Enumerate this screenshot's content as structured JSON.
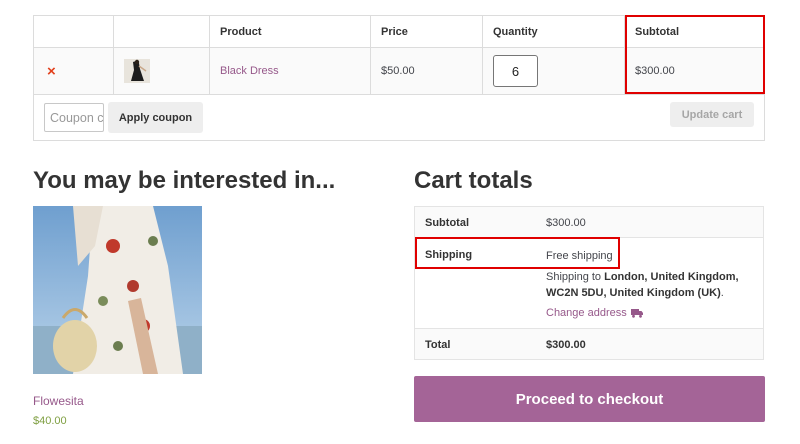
{
  "cart": {
    "headers": {
      "remove": "",
      "thumbnail": "",
      "product": "Product",
      "price": "Price",
      "quantity": "Quantity",
      "subtotal": "Subtotal"
    },
    "item": {
      "remove_symbol": "×",
      "name": "Black Dress",
      "price": "$50.00",
      "quantity": "6",
      "subtotal": "$300.00"
    },
    "coupon_placeholder": "Coupon code",
    "apply_coupon_label": "Apply coupon",
    "update_cart_label": "Update cart"
  },
  "interested": {
    "title": "You may be interested in...",
    "product_name": "Flowesita",
    "product_price": "$40.00"
  },
  "totals": {
    "title": "Cart totals",
    "subtotal_label": "Subtotal",
    "subtotal_value": "$300.00",
    "shipping_label": "Shipping",
    "shipping_method": "Free shipping",
    "shipping_to_prefix": "Shipping to",
    "shipping_address": "London, United Kingdom, WC2N 5DU, United Kingdom (UK)",
    "shipping_suffix": ".",
    "change_address_label": "Change address",
    "total_label": "Total",
    "total_value": "$300.00",
    "checkout_label": "Proceed to checkout"
  },
  "colors": {
    "accent": "#a46497",
    "link": "#96588a",
    "remove": "#e2401c",
    "price_green": "#7f9f42",
    "highlight": "#e00000"
  },
  "icons": {
    "remove": "close-icon",
    "change_address": "truck-icon"
  }
}
